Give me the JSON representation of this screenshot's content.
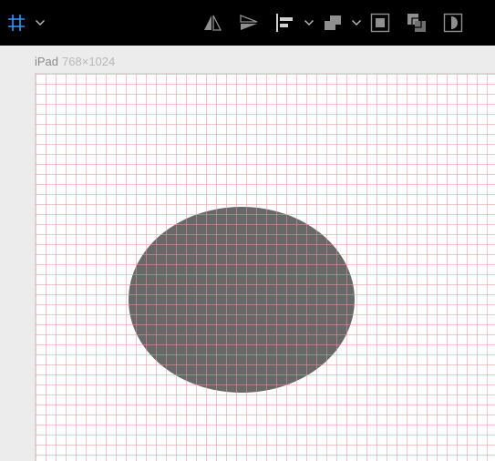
{
  "toolbar": {
    "icons": [
      "grid-icon",
      "chevron-down-icon",
      "flip-horizontal-icon",
      "flip-vertical-icon",
      "align-left-icon",
      "chevron-down-icon",
      "arrange-icon",
      "chevron-down-icon",
      "bring-forward-icon",
      "send-backward-icon",
      "mask-icon"
    ],
    "accent_color": "#2f9bff"
  },
  "artboard": {
    "name": "iPad",
    "dimensions": "768×1024",
    "grid_color": "#e696a0"
  },
  "shape": {
    "type": "ellipse",
    "fill": "#686868"
  }
}
